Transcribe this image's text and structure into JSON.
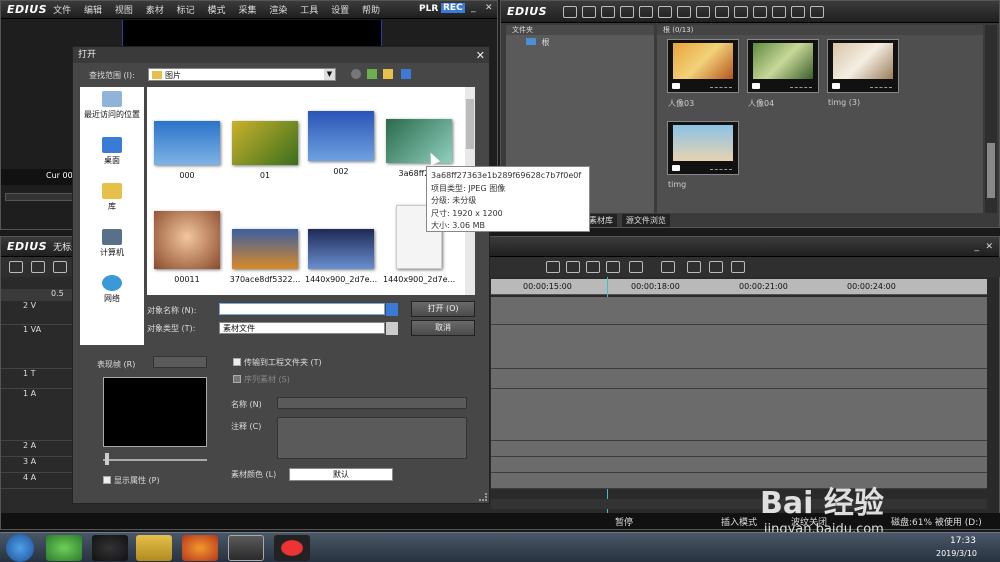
{
  "app_name": "EDIUS",
  "menu": [
    "文件",
    "编辑",
    "视图",
    "素材",
    "标记",
    "模式",
    "采集",
    "渲染",
    "工具",
    "设置",
    "帮助"
  ],
  "mode_badges": [
    "PLR",
    "REC"
  ],
  "player": {
    "cur_label": "Cur 00"
  },
  "timeline_window": {
    "app_name": "EDIUS",
    "project_name": "无标题",
    "zoom_label": "0.5"
  },
  "tracks": [
    {
      "name": "2 V"
    },
    {
      "name": "1 VA"
    },
    {
      "name": "1 T"
    },
    {
      "name": "1 A"
    },
    {
      "name": "2 A"
    },
    {
      "name": "3 A"
    },
    {
      "name": "4 A"
    }
  ],
  "ruler_times": [
    "00:00:15:00",
    "00:00:18:00",
    "00:00:21:00",
    "00:00:24:00"
  ],
  "bin": {
    "app_name": "EDIUS",
    "folder_header": "文件夹",
    "root_folder": "根",
    "content_header": "根 (0/13)",
    "clips": [
      {
        "label": "人像03"
      },
      {
        "label": "人像04"
      },
      {
        "label": "timg (3)"
      },
      {
        "label": "timg"
      }
    ],
    "tabs": [
      "素材库",
      "源文件浏览"
    ]
  },
  "dialog": {
    "title": "打开",
    "look_in_label": "查找范围 (I):",
    "look_in_value": "图片",
    "places": [
      "最近访问的位置",
      "桌面",
      "库",
      "计算机",
      "网络"
    ],
    "files": [
      {
        "name": "000"
      },
      {
        "name": "01"
      },
      {
        "name": "002"
      },
      {
        "name": "3a68ff273"
      },
      {
        "name": "00011"
      },
      {
        "name": "370ace8df5322..."
      },
      {
        "name": "1440x900_2d7e..."
      },
      {
        "name": "1440x900_2d7e..."
      }
    ],
    "object_name_label": "对象名称 (N):",
    "object_name_value": "",
    "object_type_label": "对象类型 (T):",
    "object_type_value": "素材文件",
    "open_button": "打开 (O)",
    "cancel_button": "取消",
    "preview_label": "表现帧 (R)",
    "show_props": "显示属性 (P)",
    "transfer_to_project": "传输到工程文件夹 (T)",
    "sequence_clip": "序列素材 (S)",
    "name_label": "名称 (N)",
    "comment_label": "注释 (C)",
    "clip_color_label": "素材颜色 (L)",
    "clip_color_value": "默认"
  },
  "tooltip": {
    "filename": "3a68ff27363e1b289f69628c7b7f0e0f",
    "type": "项目类型: JPEG 图像",
    "rating": "分级: 未分级",
    "dimensions": "尺寸: 1920 x 1200",
    "size": "大小: 3.06 MB"
  },
  "status_bar": {
    "pause": "暂停",
    "insert_mode": "插入模式",
    "ripple": "波纹关闭",
    "disk": "磁盘:61% 被使用 (D:)"
  },
  "taskbar": {
    "time": "17:33",
    "date": "2019/3/10"
  },
  "watermark": {
    "text": "Bai 经验",
    "url": "jingyan.baidu.com"
  }
}
